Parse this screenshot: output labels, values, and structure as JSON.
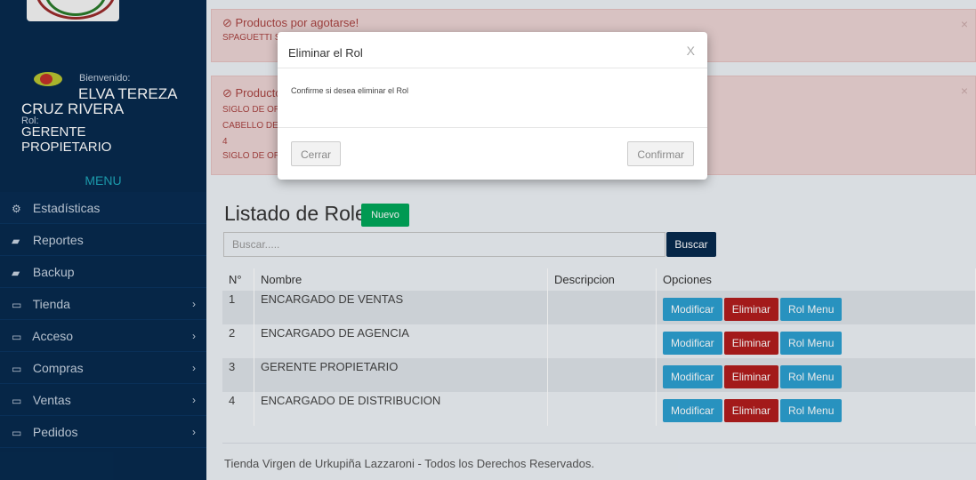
{
  "sidebar": {
    "welcome_label": "Bienvenido:",
    "user_name_line1": "ELVA TEREZA",
    "user_name_line2": "CRUZ RIVERA",
    "role_label": "Rol:",
    "role_line1": "GERENTE",
    "role_line2": "PROPIETARIO",
    "menu_title": "MENU",
    "items": [
      {
        "label": "Estadísticas",
        "icon": "dashboard-icon",
        "glyph": "⚙",
        "chevron": ""
      },
      {
        "label": "Reportes",
        "icon": "folder-icon",
        "glyph": "▰",
        "chevron": ""
      },
      {
        "label": "Backup",
        "icon": "folder-icon",
        "glyph": "▰",
        "chevron": ""
      },
      {
        "label": "Tienda",
        "icon": "laptop-icon",
        "glyph": "▭",
        "chevron": "›"
      },
      {
        "label": "Acceso",
        "icon": "laptop-icon",
        "glyph": "▭",
        "chevron": "›"
      },
      {
        "label": "Compras",
        "icon": "laptop-icon",
        "glyph": "▭",
        "chevron": "›"
      },
      {
        "label": "Ventas",
        "icon": "laptop-icon",
        "glyph": "▭",
        "chevron": "›"
      },
      {
        "label": "Pedidos",
        "icon": "laptop-icon",
        "glyph": "▭",
        "chevron": "›"
      }
    ]
  },
  "alerts": [
    {
      "title": "⊘ Productos por agotarse!",
      "items": [
        "SPAGUETTI S"
      ]
    },
    {
      "title": "⊘ Producto",
      "items": [
        "SIGLO DE OR",
        "CABELLO DE",
        "4",
        "SIGLO DE OR"
      ]
    }
  ],
  "main": {
    "title": "Listado de Roles",
    "new_button": "Nuevo",
    "search_placeholder": "Buscar.....",
    "search_button": "Buscar",
    "table": {
      "headers": [
        "N°",
        "Nombre",
        "Descripcion",
        "Opciones"
      ],
      "rows": [
        {
          "n": "1",
          "nombre": "ENCARGADO DE VENTAS",
          "descripcion": ""
        },
        {
          "n": "2",
          "nombre": "ENCARGADO DE AGENCIA",
          "descripcion": ""
        },
        {
          "n": "3",
          "nombre": "GERENTE PROPIETARIO",
          "descripcion": ""
        },
        {
          "n": "4",
          "nombre": "ENCARGADO DE DISTRIBUCION",
          "descripcion": ""
        }
      ],
      "actions": {
        "modify": "Modificar",
        "delete": "Eliminar",
        "role_menu": "Rol Menu"
      }
    },
    "footer": "Tienda Virgen de Urkupiña Lazzaroni - Todos los Derechos Reservados."
  },
  "modal": {
    "title": "Eliminar el Rol",
    "close": "X",
    "body": "Confirme si desea eliminar el Rol",
    "cancel_button": "Cerrar",
    "confirm_button": "Confirmar"
  },
  "colors": {
    "sidebar_bg": "#072a4e",
    "menu_title": "#1ea6b9",
    "success": "#00a65a",
    "info": "#2c9fd0",
    "danger": "#b11d1d",
    "alert_bg": "#ebd3d3"
  }
}
